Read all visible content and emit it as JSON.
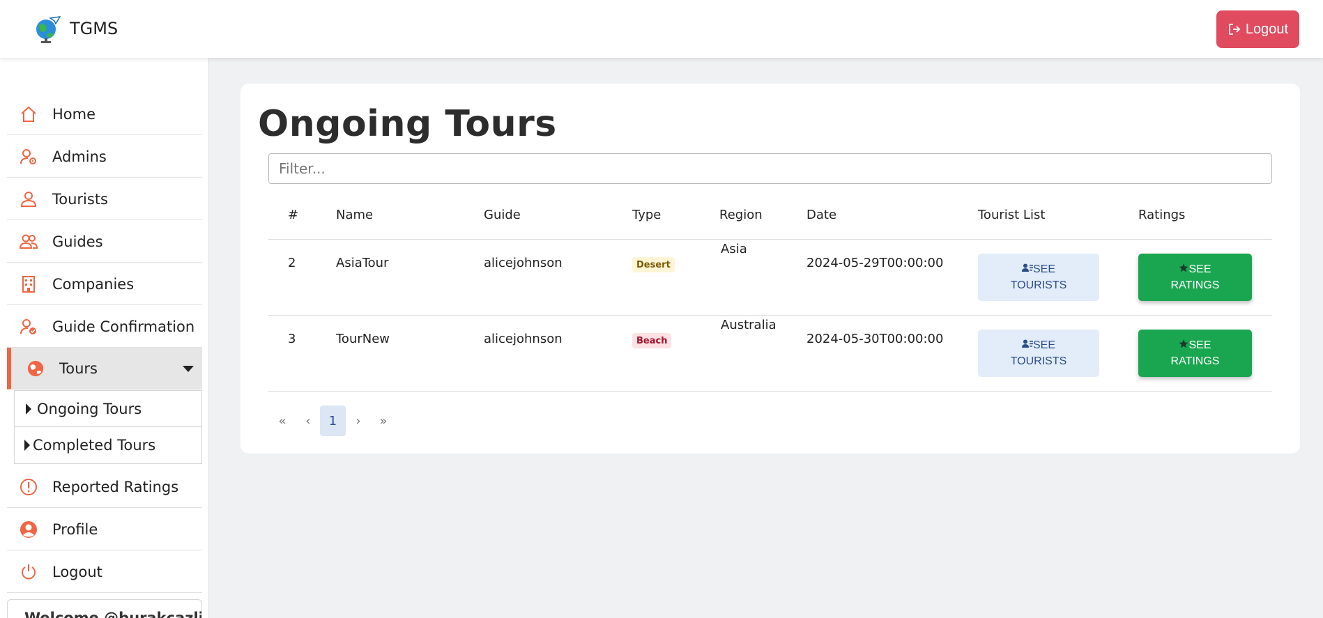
{
  "header": {
    "brand": "TGMS",
    "logout_label": "Logout"
  },
  "sidebar": {
    "items": [
      {
        "label": "Home",
        "icon": "home-icon"
      },
      {
        "label": "Admins",
        "icon": "user-gear-icon"
      },
      {
        "label": "Tourists",
        "icon": "user-icon"
      },
      {
        "label": "Guides",
        "icon": "users-icon"
      },
      {
        "label": "Companies",
        "icon": "building-icon"
      },
      {
        "label": "Guide Confirmation",
        "icon": "user-check-icon"
      },
      {
        "label": "Tours",
        "icon": "globe-icon"
      },
      {
        "label": "Reported Ratings",
        "icon": "alert-circle-icon"
      },
      {
        "label": "Profile",
        "icon": "user-circle-icon"
      },
      {
        "label": "Logout",
        "icon": "power-icon"
      }
    ],
    "tours_submenu": [
      "Ongoing Tours",
      "Completed Tours"
    ],
    "welcome": "Welcome @burakcazli"
  },
  "main": {
    "title": "Ongoing Tours",
    "filter_placeholder": "Filter...",
    "columns": [
      "#",
      "Name",
      "Guide",
      "Type",
      "Region",
      "Date",
      "Tourist List",
      "Ratings"
    ],
    "rows": [
      {
        "id": "2",
        "name": "AsiaTour",
        "guide": "alicejohnson",
        "type": "Desert",
        "region": "Asia",
        "date": "2024-05-29T00:00:00",
        "tourists_btn": [
          "SEE",
          "TOURISTS"
        ],
        "ratings_btn": [
          "SEE",
          "RATINGS"
        ]
      },
      {
        "id": "3",
        "name": "TourNew",
        "guide": "alicejohnson",
        "type": "Beach",
        "region": "Australia",
        "date": "2024-05-30T00:00:00",
        "tourists_btn": [
          "SEE",
          "TOURISTS"
        ],
        "ratings_btn": [
          "SEE",
          "RATINGS"
        ]
      }
    ],
    "pagination": {
      "first": "«",
      "prev": "‹",
      "current": "1",
      "next": "›",
      "last": "»"
    }
  },
  "colors": {
    "accent": "#f06543",
    "logout_button": "#e04b5f",
    "ratings_button": "#1aa650",
    "tourists_button": "#e3ecf9"
  }
}
